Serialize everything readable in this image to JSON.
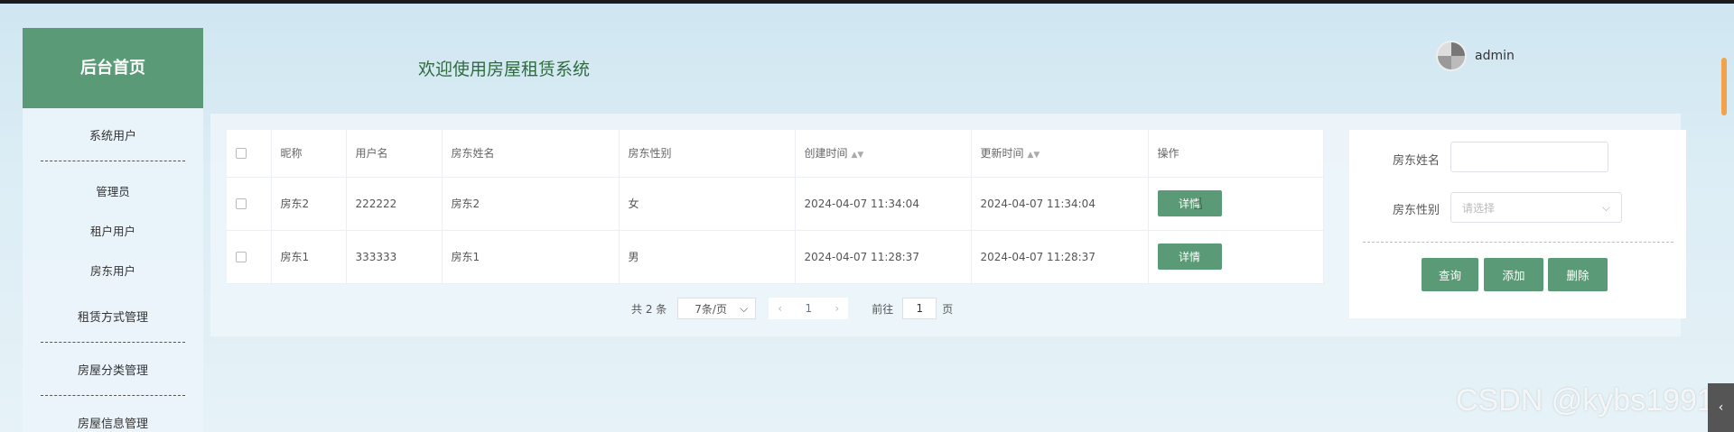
{
  "sidebar": {
    "home": "后台首页",
    "groups": [
      {
        "title": "系统用户",
        "items": [
          "管理员",
          "租户用户",
          "房东用户"
        ]
      },
      {
        "title": "租赁方式管理",
        "items": []
      },
      {
        "title": "房屋分类管理",
        "items": []
      },
      {
        "title": "房屋信息管理",
        "items": []
      }
    ]
  },
  "header": {
    "welcome": "欢迎使用房屋租赁系统",
    "username": "admin"
  },
  "table": {
    "columns": [
      "昵称",
      "用户名",
      "房东姓名",
      "房东性别",
      "创建时间",
      "更新时间",
      "操作"
    ],
    "rows": [
      {
        "nickname": "房东2",
        "username": "222222",
        "name": "房东2",
        "gender": "女",
        "created": "2024-04-07 11:34:04",
        "updated": "2024-04-07 11:34:04",
        "action": "详情"
      },
      {
        "nickname": "房东1",
        "username": "333333",
        "name": "房东1",
        "gender": "男",
        "created": "2024-04-07 11:28:37",
        "updated": "2024-04-07 11:28:37",
        "action": "详情"
      }
    ]
  },
  "pager": {
    "total": "共 2 条",
    "page_size": "7条/页",
    "current_page": "1",
    "goto_label": "前往",
    "goto_value": "1",
    "page_unit": "页"
  },
  "search": {
    "name_label": "房东姓名",
    "gender_label": "房东性别",
    "gender_placeholder": "请选择",
    "query_button": "查询",
    "add_button": "添加",
    "delete_button": "删除"
  },
  "watermark": "CSDN @kybs1991",
  "colors": {
    "accent": "#5b9a76",
    "welcome": "#2f6b3f",
    "page_active": "#3a7bd5"
  },
  "icons": {
    "sort": "sort-caret-icon",
    "select": "chevron-down-icon",
    "prev": "chevron-left-icon",
    "next": "chevron-right-icon"
  }
}
